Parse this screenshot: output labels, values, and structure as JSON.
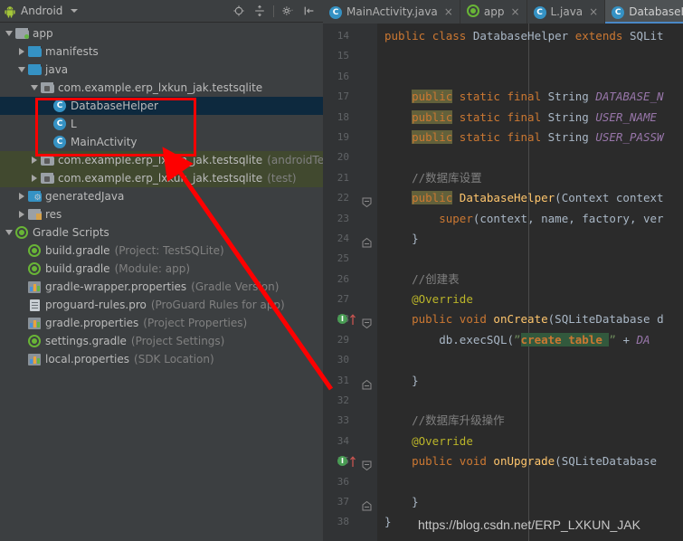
{
  "window": {
    "app": "Android Studio",
    "theme_bg": "#3c3f41",
    "editor_bg": "#2b2b2b",
    "accent": "#4a88c7",
    "annotation_color": "#fe0000"
  },
  "project_toolbar": {
    "title": "Android",
    "dropdown_caret": "chevron-down-icon",
    "icons": [
      {
        "name": "locate-target-icon",
        "glyph": "target"
      },
      {
        "name": "collapse-all-icon",
        "glyph": "collapse"
      },
      {
        "name": "settings-gear-icon",
        "glyph": "gear"
      },
      {
        "name": "hide-panel-icon",
        "glyph": "hide"
      }
    ]
  },
  "tree": [
    {
      "indent": 0,
      "arrow": "open",
      "icon": "folder-module",
      "label": "app",
      "sub": "",
      "state": "normal"
    },
    {
      "indent": 1,
      "arrow": "closed",
      "icon": "folder-blue",
      "label": "manifests",
      "sub": "",
      "state": "normal"
    },
    {
      "indent": 1,
      "arrow": "open",
      "icon": "folder-blue",
      "label": "java",
      "sub": "",
      "state": "normal"
    },
    {
      "indent": 2,
      "arrow": "open",
      "icon": "folder-package",
      "label": "com.example.erp_lxkun_jak.testsqlite",
      "sub": "",
      "state": "normal"
    },
    {
      "indent": 3,
      "arrow": "none",
      "icon": "java-class",
      "label": "DatabaseHelper",
      "sub": "",
      "state": "selected"
    },
    {
      "indent": 3,
      "arrow": "none",
      "icon": "java-class",
      "label": "L",
      "sub": "",
      "state": "normal"
    },
    {
      "indent": 3,
      "arrow": "none",
      "icon": "java-class",
      "label": "MainActivity",
      "sub": "",
      "state": "normal"
    },
    {
      "indent": 2,
      "arrow": "closed",
      "icon": "folder-package",
      "label": "com.example.erp_lxkun_jak.testsqlite",
      "sub": "(androidTest)",
      "state": "tinted"
    },
    {
      "indent": 2,
      "arrow": "closed",
      "icon": "folder-package",
      "label": "com.example.erp_lxkun_jak.testsqlite",
      "sub": "(test)",
      "state": "tinted"
    },
    {
      "indent": 1,
      "arrow": "closed",
      "icon": "folder-generated",
      "label": "generatedJava",
      "sub": "",
      "state": "normal"
    },
    {
      "indent": 1,
      "arrow": "closed",
      "icon": "folder-res",
      "label": "res",
      "sub": "",
      "state": "normal"
    },
    {
      "indent": 0,
      "arrow": "open",
      "icon": "gradle",
      "label": "Gradle Scripts",
      "sub": "",
      "state": "normal"
    },
    {
      "indent": 1,
      "arrow": "none",
      "icon": "gradle",
      "label": "build.gradle",
      "sub": "(Project: TestSQLite)",
      "state": "normal"
    },
    {
      "indent": 1,
      "arrow": "none",
      "icon": "gradle",
      "label": "build.gradle",
      "sub": "(Module: app)",
      "state": "normal"
    },
    {
      "indent": 1,
      "arrow": "none",
      "icon": "properties",
      "label": "gradle-wrapper.properties",
      "sub": "(Gradle Version)",
      "state": "normal"
    },
    {
      "indent": 1,
      "arrow": "none",
      "icon": "textfile",
      "label": "proguard-rules.pro",
      "sub": "(ProGuard Rules for app)",
      "state": "normal"
    },
    {
      "indent": 1,
      "arrow": "none",
      "icon": "properties",
      "label": "gradle.properties",
      "sub": "(Project Properties)",
      "state": "normal"
    },
    {
      "indent": 1,
      "arrow": "none",
      "icon": "gradle",
      "label": "settings.gradle",
      "sub": "(Project Settings)",
      "state": "normal"
    },
    {
      "indent": 1,
      "arrow": "none",
      "icon": "properties",
      "label": "local.properties",
      "sub": "(SDK Location)",
      "state": "normal"
    }
  ],
  "editor_tabs": [
    {
      "label": "MainActivity.java",
      "icon": "java-class-icon",
      "active": false,
      "close": "×"
    },
    {
      "label": "app",
      "icon": "gradle-icon",
      "active": false,
      "close": "×"
    },
    {
      "label": "L.java",
      "icon": "java-class-icon",
      "active": false,
      "close": "×"
    },
    {
      "label": "DatabaseHelper",
      "icon": "java-class-icon",
      "active": true,
      "close": ""
    }
  ],
  "code": {
    "first_line": 14,
    "lines": [
      {
        "n": 14,
        "fold": "none",
        "bulb": false,
        "tokens": [
          {
            "t": "public ",
            "c": "kw"
          },
          {
            "t": "class ",
            "c": "kw"
          },
          {
            "t": "DatabaseHelper ",
            "c": "typ"
          },
          {
            "t": "extends ",
            "c": "kw"
          },
          {
            "t": "SQLit",
            "c": "typ"
          }
        ]
      },
      {
        "n": 15,
        "fold": "none",
        "bulb": false,
        "tokens": []
      },
      {
        "n": 16,
        "fold": "none",
        "bulb": false,
        "tokens": []
      },
      {
        "n": 17,
        "fold": "none",
        "bulb": false,
        "tokens": [
          {
            "t": "    ",
            "c": "pl"
          },
          {
            "t": "public",
            "c": "kw-hl"
          },
          {
            "t": " ",
            "c": "pl"
          },
          {
            "t": "static final ",
            "c": "kw"
          },
          {
            "t": "String ",
            "c": "typ"
          },
          {
            "t": "DATABASE_N",
            "c": "fld"
          }
        ]
      },
      {
        "n": 18,
        "fold": "none",
        "bulb": false,
        "tokens": [
          {
            "t": "    ",
            "c": "pl"
          },
          {
            "t": "public",
            "c": "kw-hl"
          },
          {
            "t": " ",
            "c": "pl"
          },
          {
            "t": "static final ",
            "c": "kw"
          },
          {
            "t": "String ",
            "c": "typ"
          },
          {
            "t": "USER_NAME",
            "c": "fld"
          }
        ]
      },
      {
        "n": 19,
        "fold": "none",
        "bulb": false,
        "tokens": [
          {
            "t": "    ",
            "c": "pl"
          },
          {
            "t": "public",
            "c": "kw-hl"
          },
          {
            "t": " ",
            "c": "pl"
          },
          {
            "t": "static final ",
            "c": "kw"
          },
          {
            "t": "String ",
            "c": "typ"
          },
          {
            "t": "USER_PASSW",
            "c": "fld"
          }
        ]
      },
      {
        "n": 20,
        "fold": "none",
        "bulb": false,
        "tokens": []
      },
      {
        "n": 21,
        "fold": "none",
        "bulb": false,
        "tokens": [
          {
            "t": "    ",
            "c": "pl"
          },
          {
            "t": "//数据库设置",
            "c": "cmt"
          }
        ]
      },
      {
        "n": 22,
        "fold": "start",
        "bulb": false,
        "tokens": [
          {
            "t": "    ",
            "c": "pl"
          },
          {
            "t": "public",
            "c": "kw-hl"
          },
          {
            "t": " ",
            "c": "pl"
          },
          {
            "t": "DatabaseHelper",
            "c": "mth"
          },
          {
            "t": "(",
            "c": "pl"
          },
          {
            "t": "Context ",
            "c": "typ"
          },
          {
            "t": "context",
            "c": "pl"
          }
        ]
      },
      {
        "n": 23,
        "fold": "mid",
        "bulb": false,
        "tokens": [
          {
            "t": "        ",
            "c": "pl"
          },
          {
            "t": "super",
            "c": "kw"
          },
          {
            "t": "(context, name, factory, ver",
            "c": "pl"
          }
        ]
      },
      {
        "n": 24,
        "fold": "end",
        "bulb": false,
        "tokens": [
          {
            "t": "    }",
            "c": "pl"
          }
        ]
      },
      {
        "n": 25,
        "fold": "none",
        "bulb": false,
        "tokens": []
      },
      {
        "n": 26,
        "fold": "none",
        "bulb": false,
        "tokens": [
          {
            "t": "    ",
            "c": "pl"
          },
          {
            "t": "//创建表",
            "c": "cmt"
          }
        ]
      },
      {
        "n": 27,
        "fold": "none",
        "bulb": false,
        "tokens": [
          {
            "t": "    ",
            "c": "pl"
          },
          {
            "t": "@Override",
            "c": "ann"
          }
        ]
      },
      {
        "n": 28,
        "fold": "start",
        "bulb": true,
        "tokens": [
          {
            "t": "    ",
            "c": "pl"
          },
          {
            "t": "public void ",
            "c": "kw"
          },
          {
            "t": "onCreate",
            "c": "mth"
          },
          {
            "t": "(",
            "c": "pl"
          },
          {
            "t": "SQLiteDatabase ",
            "c": "typ"
          },
          {
            "t": "d",
            "c": "pl"
          }
        ]
      },
      {
        "n": 29,
        "fold": "mid",
        "bulb": false,
        "tokens": [
          {
            "t": "        db.",
            "c": "pl"
          },
          {
            "t": "execSQL",
            "c": "pl"
          },
          {
            "t": "(",
            "c": "pl"
          },
          {
            "t": "”",
            "c": "str"
          },
          {
            "t": "create table ",
            "c": "str-hl"
          },
          {
            "t": "”",
            "c": "str"
          },
          {
            "t": " + ",
            "c": "pl"
          },
          {
            "t": "DA",
            "c": "fld"
          }
        ]
      },
      {
        "n": 30,
        "fold": "none",
        "bulb": false,
        "tokens": []
      },
      {
        "n": 31,
        "fold": "end",
        "bulb": false,
        "tokens": [
          {
            "t": "    }",
            "c": "pl"
          }
        ]
      },
      {
        "n": 32,
        "fold": "none",
        "bulb": false,
        "tokens": []
      },
      {
        "n": 33,
        "fold": "none",
        "bulb": false,
        "tokens": [
          {
            "t": "    ",
            "c": "pl"
          },
          {
            "t": "//数据库升级操作",
            "c": "cmt"
          }
        ]
      },
      {
        "n": 34,
        "fold": "none",
        "bulb": false,
        "tokens": [
          {
            "t": "    ",
            "c": "pl"
          },
          {
            "t": "@Override",
            "c": "ann"
          }
        ]
      },
      {
        "n": 35,
        "fold": "start",
        "bulb": true,
        "tokens": [
          {
            "t": "    ",
            "c": "pl"
          },
          {
            "t": "public void ",
            "c": "kw"
          },
          {
            "t": "onUpgrade",
            "c": "mth"
          },
          {
            "t": "(",
            "c": "pl"
          },
          {
            "t": "SQLiteDatabase",
            "c": "typ"
          }
        ]
      },
      {
        "n": 36,
        "fold": "none",
        "bulb": false,
        "tokens": []
      },
      {
        "n": 37,
        "fold": "end",
        "bulb": false,
        "tokens": [
          {
            "t": "    }",
            "c": "pl"
          }
        ]
      },
      {
        "n": 38,
        "fold": "none",
        "bulb": false,
        "tokens": [
          {
            "t": "}",
            "c": "pl"
          }
        ]
      }
    ]
  },
  "watermark": {
    "text": "https://blog.csdn.net/ERP_LXKUN_JAK"
  },
  "annotation": {
    "red_box_label": "highlighted-java-classes",
    "arrow_label": "pointer-arrow-to-package"
  }
}
